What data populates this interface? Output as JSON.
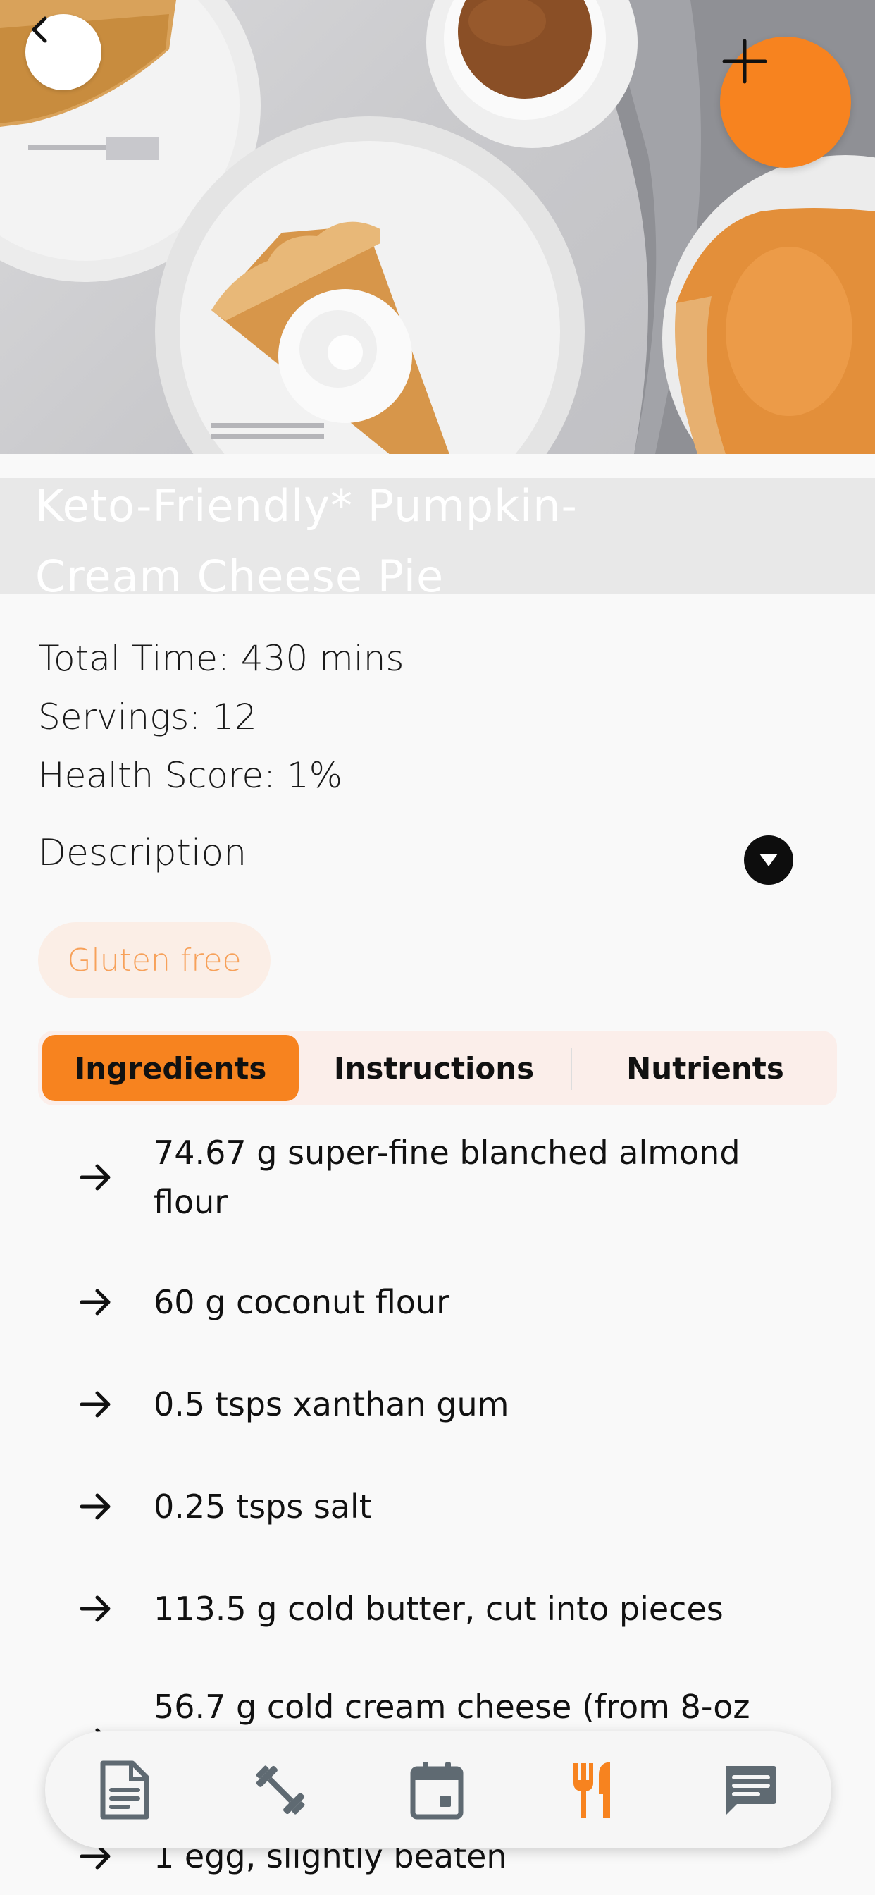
{
  "recipe": {
    "title": "Keto-Friendly* Pumpkin-Cream Cheese Pie",
    "total_time": "Total Time: 430 mins",
    "servings": "Servings: 12",
    "health_score": "Health Score: 1%",
    "description_label": "Description",
    "tags": [
      "Gluten free"
    ]
  },
  "tabs": [
    {
      "label": "Ingredients",
      "active": true
    },
    {
      "label": "Instructions",
      "active": false
    },
    {
      "label": "Nutrients",
      "active": false
    }
  ],
  "ingredients": [
    "74.67 g super-fine blanched almond flour",
    "60 g coconut flour",
    "0.5 tsps xanthan gum",
    "0.25 tsps salt",
    "113.5 g cold butter, cut into pieces",
    "56.7 g cold cream cheese (from 8-oz",
    "1 egg, slightly beaten"
  ],
  "nav": [
    {
      "icon": "document-icon",
      "active": false
    },
    {
      "icon": "dumbbell-icon",
      "active": false
    },
    {
      "icon": "calendar-icon",
      "active": false
    },
    {
      "icon": "fork-knife-icon",
      "active": true
    },
    {
      "icon": "chat-icon",
      "active": false
    }
  ],
  "colors": {
    "accent": "#f7831f",
    "tag_bg": "#fbeee6",
    "tag_text": "#f7a15a",
    "tabs_bg": "#fbeeea",
    "nav_icon": "#5f6a72"
  },
  "icons": {
    "back": "chevron-left-icon",
    "add": "plus-icon",
    "description_toggle": "caret-down-icon",
    "ingredient_bullet": "arrow-right-icon"
  }
}
